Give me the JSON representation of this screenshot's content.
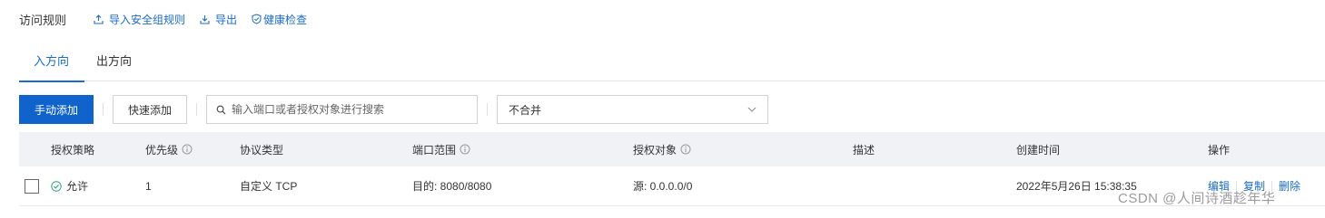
{
  "header": {
    "title": "访问规则",
    "actions": [
      {
        "label": "导入安全组规则",
        "icon": "upload-icon"
      },
      {
        "label": "导出",
        "icon": "download-icon"
      },
      {
        "label": "健康检查",
        "icon": "shield-check-icon"
      }
    ]
  },
  "tabs": [
    {
      "label": "入方向",
      "active": true
    },
    {
      "label": "出方向",
      "active": false
    }
  ],
  "toolbar": {
    "manual_add_label": "手动添加",
    "quick_add_label": "快速添加",
    "search_placeholder": "输入端口或者授权对象进行搜索",
    "merge_select_value": "不合并"
  },
  "table": {
    "columns": [
      "授权策略",
      "优先级",
      "协议类型",
      "端口范围",
      "授权对象",
      "描述",
      "创建时间",
      "操作"
    ],
    "rows": [
      {
        "policy": "允许",
        "priority": "1",
        "protocol": "自定义 TCP",
        "port_range": "目的: 8080/8080",
        "auth_object": "源: 0.0.0.0/0",
        "description": "",
        "created_at": "2022年5月26日 15:38:35",
        "ops": [
          "编辑",
          "复制",
          "删除"
        ]
      }
    ]
  },
  "watermark": "CSDN @人间诗酒趁年华",
  "colors": {
    "primary": "#0f63cb",
    "link": "#1a6cc4",
    "header_bg": "#f0f2f5",
    "allow_green": "#2ba471"
  }
}
